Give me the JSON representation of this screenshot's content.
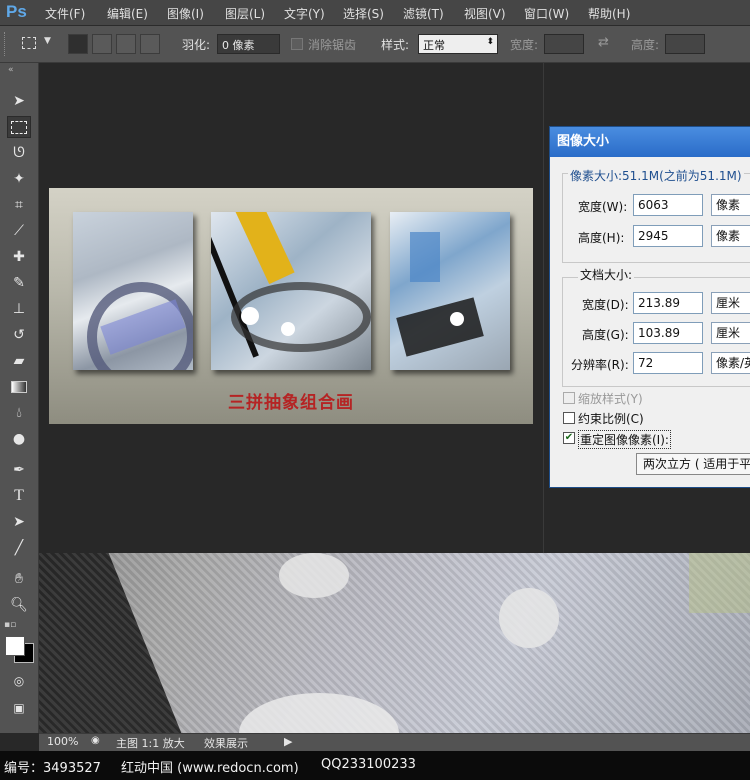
{
  "app": {
    "logo": "Ps"
  },
  "menu": [
    "文件(F)",
    "编辑(E)",
    "图像(I)",
    "图层(L)",
    "文字(Y)",
    "选择(S)",
    "滤镜(T)",
    "视图(V)",
    "窗口(W)",
    "帮助(H)"
  ],
  "options": {
    "feather_label": "羽化:",
    "feather_value": "0 像素",
    "antialias_label": "消除锯齿",
    "style_label": "样式:",
    "style_value": "正常",
    "width_label": "宽度:",
    "height_label": "高度:"
  },
  "tools": [
    "move-tool",
    "marquee-tool",
    "lasso-tool",
    "magic-wand-tool",
    "crop-tool",
    "eyedropper-tool",
    "healing-brush-tool",
    "brush-tool",
    "clone-stamp-tool",
    "history-brush-tool",
    "eraser-tool",
    "gradient-tool",
    "blur-tool",
    "dodge-tool",
    "pen-tool",
    "type-tool",
    "path-selection-tool",
    "line-tool",
    "hand-tool",
    "zoom-tool"
  ],
  "artwork": {
    "title": "三拼抽象组合画"
  },
  "dialog": {
    "title": "图像大小",
    "pixel_dimensions": "像素大小:51.1M(之前为51.1M)",
    "width_label": "宽度(W):",
    "width_value": "6063",
    "width_unit": "像素",
    "height_label": "高度(H):",
    "height_value": "2945",
    "height_unit": "像素",
    "document_size": "文档大小:",
    "doc_width_label": "宽度(D):",
    "doc_width_value": "213.89",
    "doc_width_unit": "厘米",
    "doc_height_label": "高度(G):",
    "doc_height_value": "103.89",
    "doc_height_unit": "厘米",
    "resolution_label": "分辨率(R):",
    "resolution_value": "72",
    "resolution_unit": "像素/英",
    "scale_styles": "缩放样式(Y)",
    "constrain": "约束比例(C)",
    "resample": "重定图像像素(I):",
    "resample_method": "两次立方 ( 适用于平"
  },
  "status": {
    "zoom": "100%",
    "doc": "主图 1:1 放大",
    "effect": "效果展示"
  },
  "watermark": {
    "id": "编号：3493527",
    "site": "红动中国 (www.redocn.com)",
    "qq": "QQ233100233"
  },
  "colors": {
    "accent": "#2a6cc8",
    "title_red": "#b52424",
    "ui_dark": "#282828",
    "ui_panel": "#535353"
  }
}
